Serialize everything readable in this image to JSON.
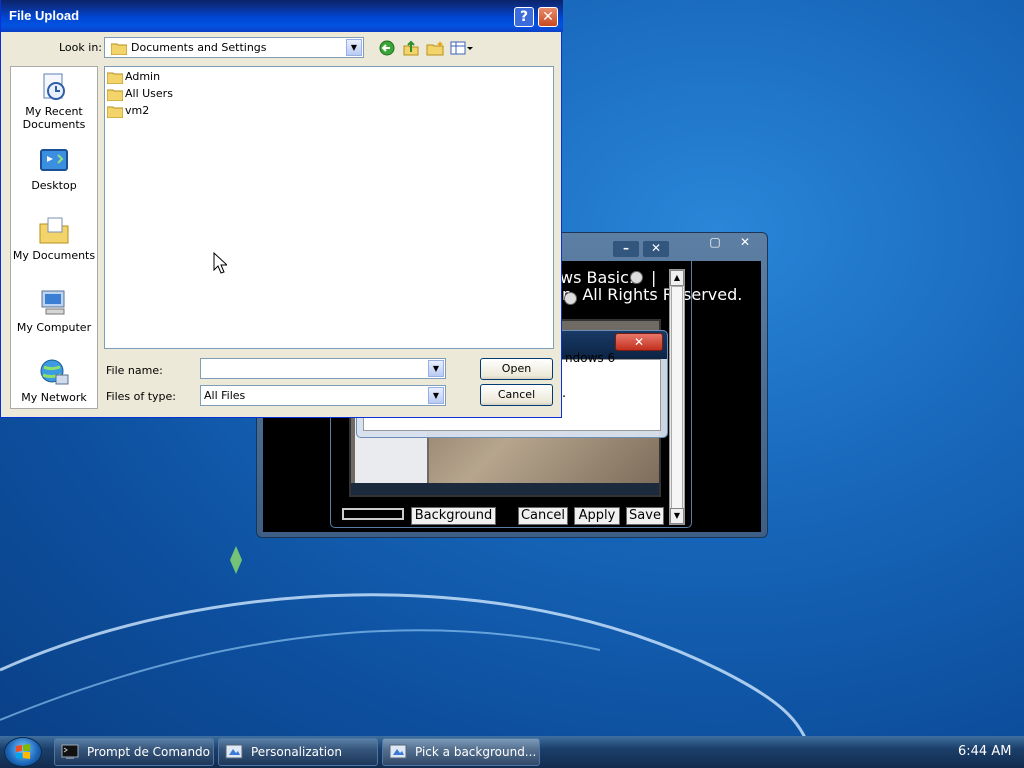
{
  "file_upload": {
    "title": "File Upload",
    "help_label": "?",
    "close_label": "✕",
    "look_in_label": "Look in:",
    "look_in_value": "Documents and Settings",
    "places": [
      {
        "label": "My Recent Documents",
        "icon": "recent-documents-icon"
      },
      {
        "label": "Desktop",
        "icon": "desktop-icon"
      },
      {
        "label": "My Documents",
        "icon": "my-documents-icon"
      },
      {
        "label": "My Computer",
        "icon": "my-computer-icon"
      },
      {
        "label": "My Network",
        "icon": "my-network-icon"
      }
    ],
    "files": [
      "Admin",
      "All Users",
      "vm2"
    ],
    "file_name_label": "File name:",
    "file_name_value": "",
    "files_of_type_label": "Files of type:",
    "files_of_type_value": "All Files",
    "open_label": "Open",
    "cancel_label": "Cancel"
  },
  "background_window": {
    "text_line1": "ws Basic:",
    "text_line1_sep": "|",
    "text_line2": "n. All Rights Reserved.",
    "inner_dialog_text": "ndows 6",
    "inner_dialog_dot": ".",
    "background_btn": "Background",
    "cancel_btn": "Cancel",
    "apply_btn": "Apply",
    "save_btn": "Save"
  },
  "taskbar": {
    "items": [
      {
        "label": "Prompt de Comando",
        "icon": "command-prompt-icon"
      },
      {
        "label": "Personalization",
        "icon": "personalization-icon"
      },
      {
        "label": "Pick a background...",
        "icon": "personalization-icon",
        "active": true
      }
    ],
    "clock": "6:44 AM"
  },
  "colors": {
    "xp_title": "#0046d5",
    "desktop": "#1868bc",
    "dialog_face": "#ece9d8"
  }
}
